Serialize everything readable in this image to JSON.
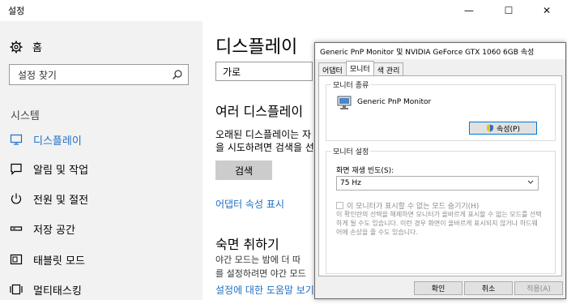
{
  "window": {
    "title": "설정",
    "minimize": "—",
    "maximize": "☐",
    "close": "✕"
  },
  "sidebar": {
    "home": "홈",
    "search_placeholder": "설정 찾기",
    "section": "시스템",
    "items": [
      {
        "label": "디스플레이",
        "icon": "monitor-icon",
        "active": true
      },
      {
        "label": "알림 및 작업",
        "icon": "notification-icon"
      },
      {
        "label": "전원 및 절전",
        "icon": "power-icon"
      },
      {
        "label": "저장 공간",
        "icon": "storage-icon"
      },
      {
        "label": "태블릿 모드",
        "icon": "tablet-icon"
      },
      {
        "label": "멀티태스킹",
        "icon": "multitasking-icon"
      }
    ]
  },
  "main": {
    "title": "디스플레이",
    "orientation_value": "가로",
    "multi_display_heading": "여러 디스플레이",
    "multi_display_text_1": "오래된 디스플레이는 자",
    "multi_display_text_2": "을 시도하려면 검색을 선",
    "search_button": "검색",
    "adapter_link": "어댑터 속성 표시",
    "night_heading": "숙면 취하기",
    "night_text_1": "야간 모드는 밤에 더 따",
    "night_text_2": "를 설정하려면 야간 모드",
    "help_link": "설정에 대한 도움말 보기"
  },
  "dialog": {
    "title": "Generic PnP Monitor 및 NVIDIA GeForce GTX 1060 6GB 속성",
    "tabs": [
      "어댑터",
      "모니터",
      "색 관리"
    ],
    "monitor_type_group": "모니터 종류",
    "monitor_name": "Generic PnP Monitor",
    "properties_button": "속성(P)",
    "monitor_settings_group": "모니터 설정",
    "refresh_label": "화면 재생 빈도(S):",
    "refresh_value": "75 Hz",
    "hide_modes_label": "이 모니터가 표시할 수 없는 모드 숨기기(H)",
    "hide_modes_desc": "이 확인란의 선택을 해제하면 모니터가 올바르게 표시할 수 없는 모드를 선택하게 될 수도 있습니다. 이런 경우 화면이 올바르게 표시되지 않거나 하드웨어에 손상을 줄 수도 있습니다.",
    "ok": "확인",
    "cancel": "취소",
    "apply": "적용(A)"
  },
  "colors": {
    "accent": "#1f6fc4",
    "sidebar_bg": "#f2f2f2",
    "dialog_bg": "#f0f0f0"
  }
}
